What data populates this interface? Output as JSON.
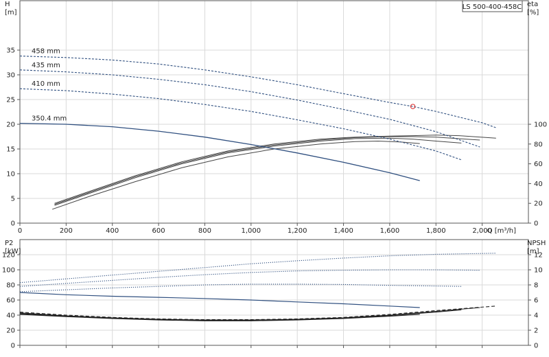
{
  "title_box": "LS 500-400-458C",
  "chart_data": [
    {
      "type": "line",
      "panel": "top",
      "x_axis": {
        "label": "Q [m³/h]",
        "lim": [
          0,
          2200
        ],
        "ticks": [
          0,
          200,
          400,
          600,
          800,
          1000,
          1200,
          1400,
          1600,
          1800,
          2000
        ],
        "tick_labels": [
          "0",
          "200",
          "400",
          "600",
          "800",
          "1,000",
          "1,200",
          "1,400",
          "1,600",
          "1,800",
          "2,000"
        ]
      },
      "y_left": {
        "label_line1": "H",
        "label_line2": "[m]",
        "lim": [
          0,
          45
        ],
        "ticks": [
          0,
          5,
          10,
          15,
          20,
          25,
          30,
          35
        ],
        "tick_labels": [
          "0",
          "5",
          "10",
          "15",
          "20",
          "25",
          "30",
          "35"
        ]
      },
      "y_right": {
        "label_line1": "eta",
        "label_line2": "[%]",
        "lim": [
          0,
          225
        ],
        "ticks": [
          0,
          20,
          40,
          60,
          80,
          100
        ],
        "tick_labels": [
          "0",
          "20",
          "40",
          "60",
          "80",
          "100"
        ]
      },
      "grid": true,
      "head_curves": [
        {
          "label": "458 mm",
          "style": "dotted-dashed",
          "color": "#2f4f7f",
          "points": [
            [
              0,
              33.8
            ],
            [
              200,
              33.5
            ],
            [
              400,
              33.0
            ],
            [
              600,
              32.2
            ],
            [
              800,
              31.0
            ],
            [
              1000,
              29.6
            ],
            [
              1200,
              28.0
            ],
            [
              1400,
              26.2
            ],
            [
              1600,
              24.4
            ],
            [
              1700,
              23.6
            ],
            [
              1800,
              22.6
            ],
            [
              2000,
              20.3
            ],
            [
              2060,
              19.3
            ]
          ]
        },
        {
          "label": "435 mm",
          "style": "dotted-dashed",
          "color": "#2f4f7f",
          "points": [
            [
              0,
              31.0
            ],
            [
              200,
              30.6
            ],
            [
              400,
              30.0
            ],
            [
              600,
              29.1
            ],
            [
              800,
              28.0
            ],
            [
              1000,
              26.6
            ],
            [
              1200,
              24.9
            ],
            [
              1400,
              23.0
            ],
            [
              1600,
              21.0
            ],
            [
              1800,
              18.5
            ],
            [
              1990,
              15.4
            ]
          ]
        },
        {
          "label": "410 mm",
          "style": "dotted-dashed",
          "color": "#2f4f7f",
          "points": [
            [
              0,
              27.2
            ],
            [
              200,
              26.8
            ],
            [
              400,
              26.1
            ],
            [
              600,
              25.2
            ],
            [
              800,
              24.0
            ],
            [
              1000,
              22.6
            ],
            [
              1200,
              20.9
            ],
            [
              1400,
              19.1
            ],
            [
              1600,
              17.0
            ],
            [
              1800,
              14.6
            ],
            [
              1910,
              12.8
            ]
          ]
        },
        {
          "label": "350.4 mm",
          "style": "solid",
          "color": "#2f4f7f",
          "points": [
            [
              0,
              20.2
            ],
            [
              200,
              20.0
            ],
            [
              400,
              19.5
            ],
            [
              600,
              18.6
            ],
            [
              800,
              17.4
            ],
            [
              1000,
              15.9
            ],
            [
              1200,
              14.2
            ],
            [
              1400,
              12.3
            ],
            [
              1600,
              10.2
            ],
            [
              1730,
              8.6
            ]
          ]
        }
      ],
      "efficiency_curves": [
        {
          "style": "solid",
          "color": "#444444",
          "points": [
            [
              150,
              20
            ],
            [
              300,
              32
            ],
            [
              500,
              48
            ],
            [
              700,
              62
            ],
            [
              900,
              73
            ],
            [
              1100,
              80
            ],
            [
              1300,
              85
            ],
            [
              1450,
              87
            ],
            [
              1600,
              88
            ],
            [
              1700,
              88.5
            ],
            [
              1800,
              89
            ],
            [
              1900,
              88.5
            ],
            [
              2060,
              86
            ]
          ]
        },
        {
          "style": "solid",
          "color": "#444444",
          "points": [
            [
              150,
              19
            ],
            [
              300,
              31
            ],
            [
              500,
              47
            ],
            [
              700,
              61
            ],
            [
              900,
              72
            ],
            [
              1100,
              79
            ],
            [
              1300,
              84
            ],
            [
              1450,
              86.5
            ],
            [
              1600,
              87.5
            ],
            [
              1700,
              87.5
            ],
            [
              1800,
              87
            ],
            [
              1990,
              84
            ]
          ]
        },
        {
          "style": "solid",
          "color": "#444444",
          "points": [
            [
              150,
              18
            ],
            [
              300,
              30
            ],
            [
              500,
              46
            ],
            [
              700,
              60
            ],
            [
              900,
              71
            ],
            [
              1100,
              78
            ],
            [
              1300,
              83
            ],
            [
              1450,
              85.5
            ],
            [
              1600,
              86
            ],
            [
              1700,
              85
            ],
            [
              1800,
              83
            ],
            [
              1910,
              81
            ]
          ]
        },
        {
          "style": "solid",
          "color": "#444444",
          "points": [
            [
              140,
              14
            ],
            [
              300,
              27
            ],
            [
              500,
              42
            ],
            [
              700,
              56
            ],
            [
              900,
              67
            ],
            [
              1100,
              75
            ],
            [
              1300,
              80
            ],
            [
              1450,
              82.5
            ],
            [
              1550,
              83
            ],
            [
              1650,
              82
            ],
            [
              1730,
              80.5
            ]
          ]
        }
      ],
      "duty_point": {
        "q": 1700,
        "h": 23.6
      }
    },
    {
      "type": "line",
      "panel": "bottom",
      "x_axis": {
        "lim": [
          0,
          2200
        ],
        "ticks": [
          0,
          200,
          400,
          600,
          800,
          1000,
          1200,
          1400,
          1600,
          1800,
          2000
        ]
      },
      "y_left": {
        "label_line1": "P2",
        "label_line2": "[kW]",
        "lim": [
          0,
          140
        ],
        "ticks": [
          0,
          20,
          40,
          60,
          80,
          100,
          120
        ],
        "tick_labels": [
          "0",
          "20",
          "40",
          "60",
          "80",
          "100",
          "120"
        ]
      },
      "y_right": {
        "label_line1": "NPSH",
        "label_line2": "[m]",
        "lim": [
          0,
          14
        ],
        "ticks": [
          0,
          2,
          4,
          6,
          8,
          10,
          12
        ],
        "tick_labels": [
          "0",
          "2",
          "4",
          "6",
          "8",
          "10",
          "12"
        ]
      },
      "grid": true,
      "power_curves": [
        {
          "style": "dotted",
          "color": "#2f4f7f",
          "points": [
            [
              0,
              83
            ],
            [
              200,
              88
            ],
            [
              400,
              93
            ],
            [
              600,
              98
            ],
            [
              800,
              103
            ],
            [
              1000,
              108
            ],
            [
              1200,
              112
            ],
            [
              1400,
              115.5
            ],
            [
              1600,
              118.5
            ],
            [
              1800,
              120.5
            ],
            [
              2060,
              122
            ]
          ]
        },
        {
          "style": "dotted",
          "color": "#2f4f7f",
          "points": [
            [
              0,
              78
            ],
            [
              200,
              82
            ],
            [
              400,
              86
            ],
            [
              600,
              90
            ],
            [
              800,
              93.5
            ],
            [
              1000,
              96.5
            ],
            [
              1200,
              98.5
            ],
            [
              1400,
              99.5
            ],
            [
              1600,
              100
            ],
            [
              1800,
              100
            ],
            [
              1990,
              99.5
            ]
          ]
        },
        {
          "style": "dotted",
          "color": "#2f4f7f",
          "points": [
            [
              0,
              71
            ],
            [
              200,
              73.5
            ],
            [
              400,
              76
            ],
            [
              600,
              78
            ],
            [
              800,
              80
            ],
            [
              1000,
              81
            ],
            [
              1200,
              81
            ],
            [
              1400,
              80.5
            ],
            [
              1600,
              79.5
            ],
            [
              1800,
              78.5
            ],
            [
              1910,
              78
            ]
          ]
        },
        {
          "style": "solid",
          "color": "#2f4f7f",
          "points": [
            [
              0,
              70
            ],
            [
              200,
              67
            ],
            [
              400,
              65
            ],
            [
              600,
              63.5
            ],
            [
              800,
              62
            ],
            [
              1000,
              60
            ],
            [
              1200,
              57.5
            ],
            [
              1400,
              55
            ],
            [
              1600,
              52
            ],
            [
              1730,
              50
            ]
          ]
        }
      ],
      "npsh_curves": [
        {
          "style": "dashed",
          "color": "#222222",
          "points": [
            [
              0,
              4.4
            ],
            [
              200,
              4.0
            ],
            [
              400,
              3.7
            ],
            [
              600,
              3.5
            ],
            [
              800,
              3.4
            ],
            [
              1000,
              3.4
            ],
            [
              1200,
              3.5
            ],
            [
              1400,
              3.7
            ],
            [
              1600,
              4.1
            ],
            [
              1800,
              4.6
            ],
            [
              2060,
              5.2
            ]
          ]
        },
        {
          "style": "solid",
          "color": "#222222",
          "points": [
            [
              0,
              4.3
            ],
            [
              200,
              3.9
            ],
            [
              400,
              3.65
            ],
            [
              600,
              3.45
            ],
            [
              800,
              3.35
            ],
            [
              1000,
              3.35
            ],
            [
              1200,
              3.45
            ],
            [
              1400,
              3.65
            ],
            [
              1600,
              4.0
            ],
            [
              1800,
              4.5
            ],
            [
              1990,
              5.0
            ]
          ]
        },
        {
          "style": "solid",
          "color": "#222222",
          "points": [
            [
              0,
              4.2
            ],
            [
              200,
              3.85
            ],
            [
              400,
              3.6
            ],
            [
              600,
              3.4
            ],
            [
              800,
              3.3
            ],
            [
              1000,
              3.3
            ],
            [
              1200,
              3.4
            ],
            [
              1400,
              3.6
            ],
            [
              1600,
              3.95
            ],
            [
              1800,
              4.4
            ],
            [
              1910,
              4.7
            ]
          ]
        },
        {
          "style": "solid",
          "color": "#222222",
          "points": [
            [
              0,
              4.1
            ],
            [
              200,
              3.8
            ],
            [
              400,
              3.55
            ],
            [
              600,
              3.35
            ],
            [
              800,
              3.25
            ],
            [
              1000,
              3.25
            ],
            [
              1200,
              3.35
            ],
            [
              1400,
              3.55
            ],
            [
              1600,
              3.85
            ],
            [
              1730,
              4.1
            ]
          ]
        }
      ]
    }
  ]
}
